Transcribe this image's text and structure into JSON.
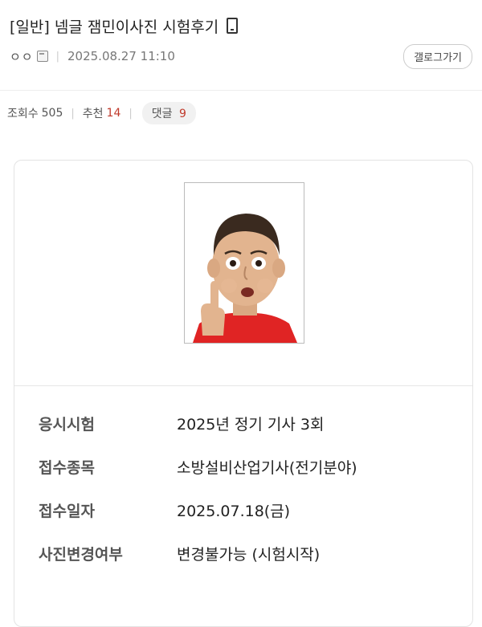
{
  "post": {
    "category": "[일반]",
    "title": "넴글 잼민이사진 시험후기",
    "nickname": "ㅇㅇ",
    "datetime": "2025.08.27 11:10",
    "gallery_button": "갤로그가기"
  },
  "stats": {
    "views_label": "조회수",
    "views": "505",
    "recommend_label": "추천",
    "recommend": "14",
    "comments_label": "댓글",
    "comments": "9"
  },
  "exam_info": [
    {
      "label": "응시시험",
      "value": "2025년 정기 기사 3회"
    },
    {
      "label": "접수종목",
      "value": "소방설비산업기사(전기분야)"
    },
    {
      "label": "접수일자",
      "value": "2025.07.18(금)"
    },
    {
      "label": "사진변경여부",
      "value": "변경불가능 (시험시작)"
    }
  ],
  "colors": {
    "accent_red": "#c0392b",
    "shirt": "#e02424"
  }
}
